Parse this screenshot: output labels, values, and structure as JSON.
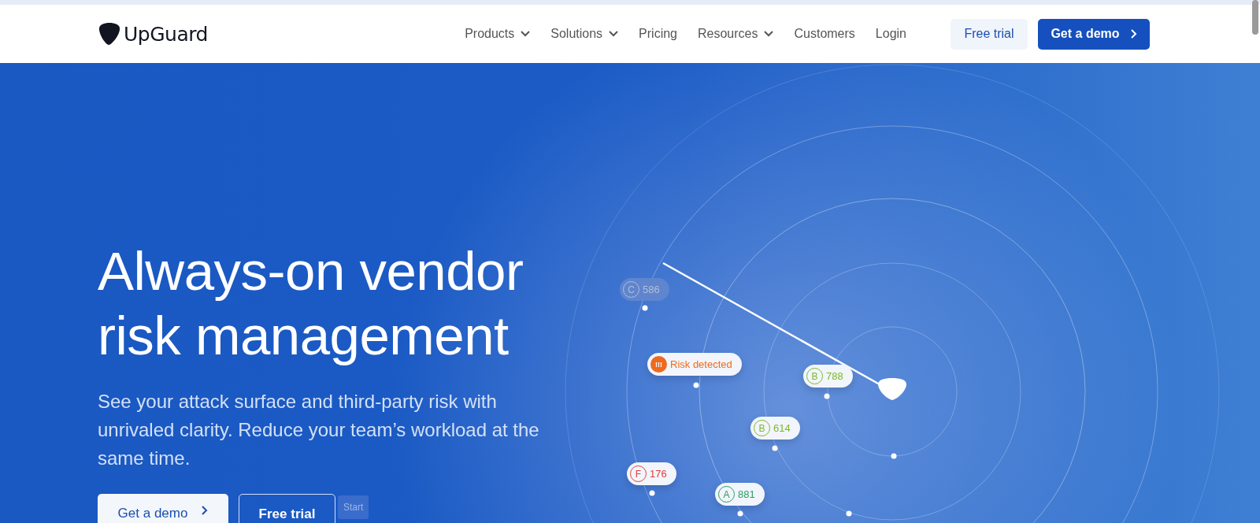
{
  "header": {
    "logo": "UpGuard",
    "nav": [
      {
        "label": "Products",
        "dropdown": true
      },
      {
        "label": "Solutions",
        "dropdown": true
      },
      {
        "label": "Pricing",
        "dropdown": false
      },
      {
        "label": "Resources",
        "dropdown": true
      },
      {
        "label": "Customers",
        "dropdown": false
      },
      {
        "label": "Login",
        "dropdown": false
      }
    ],
    "free_trial": "Free trial",
    "get_demo": "Get a demo"
  },
  "hero": {
    "title": "Always-on vendor risk management",
    "subtitle": "See your attack surface and third-party risk with unrivaled clarity. Reduce your team’s workload at the same time.",
    "buttons": [
      {
        "label": "Get a demo",
        "kind": "primary"
      },
      {
        "label": "Free trial",
        "kind": "outline"
      }
    ],
    "tooltip": "Start"
  },
  "radar": {
    "badges": [
      {
        "kind": "faded_grade",
        "grade": "C",
        "score": "586",
        "color": "#b4bfd6"
      },
      {
        "kind": "alert",
        "icon": "!!!",
        "text": "Risk detected",
        "color": "#ee6a1f"
      },
      {
        "kind": "grade",
        "grade": "B",
        "score": "788",
        "color": "#7cb82c"
      },
      {
        "kind": "grade",
        "grade": "B",
        "score": "614",
        "color": "#7cb82c"
      },
      {
        "kind": "grade",
        "grade": "F",
        "score": "176",
        "color": "#e0403a"
      },
      {
        "kind": "grade",
        "grade": "A",
        "score": "881",
        "color": "#2a9e62"
      }
    ]
  }
}
